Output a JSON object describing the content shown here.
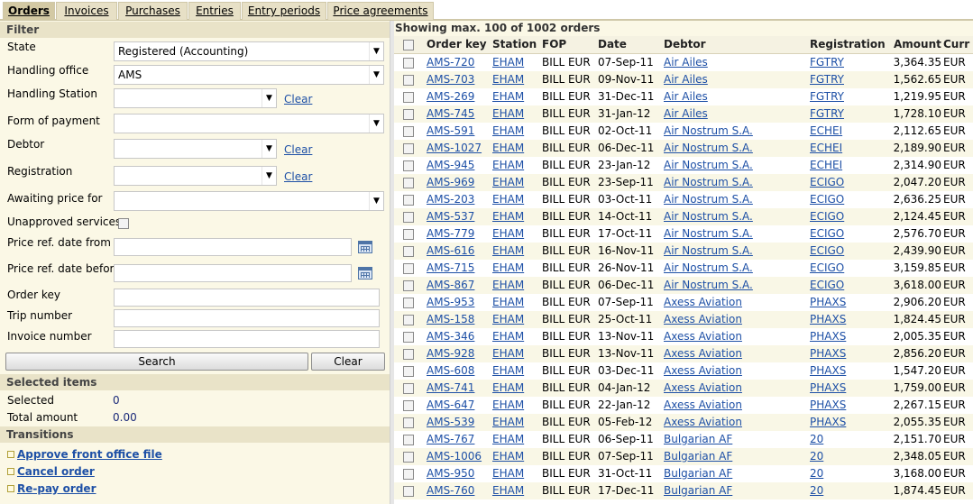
{
  "tabs": [
    {
      "label": "Orders",
      "active": true
    },
    {
      "label": "Invoices",
      "active": false
    },
    {
      "label": "Purchases",
      "active": false
    },
    {
      "label": "Entries",
      "active": false
    },
    {
      "label": "Entry periods",
      "active": false
    },
    {
      "label": "Price agreements",
      "active": false
    }
  ],
  "filter": {
    "header": "Filter",
    "state_label": "State",
    "state_value": "Registered (Accounting)",
    "handling_office_label": "Handling office",
    "handling_office_value": "AMS",
    "handling_station_label": "Handling Station",
    "form_of_payment_label": "Form of payment",
    "debtor_label": "Debtor",
    "registration_label": "Registration",
    "awaiting_price_label": "Awaiting price for",
    "unapproved_label": "Unapproved services",
    "price_from_label": "Price ref. date from",
    "price_before_label": "Price ref. date before",
    "order_key_label": "Order key",
    "trip_number_label": "Trip number",
    "invoice_number_label": "Invoice number",
    "clear_link": "Clear",
    "search_button": "Search",
    "clear_button": "Clear"
  },
  "selected": {
    "header": "Selected items",
    "selected_label": "Selected",
    "selected_value": "0",
    "total_label": "Total amount",
    "total_value": "0.00"
  },
  "transitions": {
    "header": "Transitions",
    "items": [
      "Approve front office file",
      "Cancel order",
      "Re-pay order"
    ]
  },
  "orders": {
    "showing": "Showing max. 100 of 1002 orders",
    "columns": [
      "Order key",
      "Station",
      "FOP",
      "Date",
      "Debtor",
      "Registration",
      "Amount",
      "Curr"
    ],
    "rows": [
      [
        "AMS-720",
        "EHAM",
        "BILL EUR",
        "07-Sep-11",
        "Air Ailes",
        "FGTRY",
        "3,364.35",
        "EUR"
      ],
      [
        "AMS-703",
        "EHAM",
        "BILL EUR",
        "09-Nov-11",
        "Air Ailes",
        "FGTRY",
        "1,562.65",
        "EUR"
      ],
      [
        "AMS-269",
        "EHAM",
        "BILL EUR",
        "31-Dec-11",
        "Air Ailes",
        "FGTRY",
        "1,219.95",
        "EUR"
      ],
      [
        "AMS-745",
        "EHAM",
        "BILL EUR",
        "31-Jan-12",
        "Air Ailes",
        "FGTRY",
        "1,728.10",
        "EUR"
      ],
      [
        "AMS-591",
        "EHAM",
        "BILL EUR",
        "02-Oct-11",
        "Air Nostrum S.A.",
        "ECHEI",
        "2,112.65",
        "EUR"
      ],
      [
        "AMS-1027",
        "EHAM",
        "BILL EUR",
        "06-Dec-11",
        "Air Nostrum S.A.",
        "ECHEI",
        "2,189.90",
        "EUR"
      ],
      [
        "AMS-945",
        "EHAM",
        "BILL EUR",
        "23-Jan-12",
        "Air Nostrum S.A.",
        "ECHEI",
        "2,314.90",
        "EUR"
      ],
      [
        "AMS-969",
        "EHAM",
        "BILL EUR",
        "23-Sep-11",
        "Air Nostrum S.A.",
        "ECIGO",
        "2,047.20",
        "EUR"
      ],
      [
        "AMS-203",
        "EHAM",
        "BILL EUR",
        "03-Oct-11",
        "Air Nostrum S.A.",
        "ECIGO",
        "2,636.25",
        "EUR"
      ],
      [
        "AMS-537",
        "EHAM",
        "BILL EUR",
        "14-Oct-11",
        "Air Nostrum S.A.",
        "ECIGO",
        "2,124.45",
        "EUR"
      ],
      [
        "AMS-779",
        "EHAM",
        "BILL EUR",
        "17-Oct-11",
        "Air Nostrum S.A.",
        "ECIGO",
        "2,576.70",
        "EUR"
      ],
      [
        "AMS-616",
        "EHAM",
        "BILL EUR",
        "16-Nov-11",
        "Air Nostrum S.A.",
        "ECIGO",
        "2,439.90",
        "EUR"
      ],
      [
        "AMS-715",
        "EHAM",
        "BILL EUR",
        "26-Nov-11",
        "Air Nostrum S.A.",
        "ECIGO",
        "3,159.85",
        "EUR"
      ],
      [
        "AMS-867",
        "EHAM",
        "BILL EUR",
        "06-Dec-11",
        "Air Nostrum S.A.",
        "ECIGO",
        "3,618.00",
        "EUR"
      ],
      [
        "AMS-953",
        "EHAM",
        "BILL EUR",
        "07-Sep-11",
        "Axess Aviation",
        "PHAXS",
        "2,906.20",
        "EUR"
      ],
      [
        "AMS-158",
        "EHAM",
        "BILL EUR",
        "25-Oct-11",
        "Axess Aviation",
        "PHAXS",
        "1,824.45",
        "EUR"
      ],
      [
        "AMS-346",
        "EHAM",
        "BILL EUR",
        "13-Nov-11",
        "Axess Aviation",
        "PHAXS",
        "2,005.35",
        "EUR"
      ],
      [
        "AMS-928",
        "EHAM",
        "BILL EUR",
        "13-Nov-11",
        "Axess Aviation",
        "PHAXS",
        "2,856.20",
        "EUR"
      ],
      [
        "AMS-608",
        "EHAM",
        "BILL EUR",
        "03-Dec-11",
        "Axess Aviation",
        "PHAXS",
        "1,547.20",
        "EUR"
      ],
      [
        "AMS-741",
        "EHAM",
        "BILL EUR",
        "04-Jan-12",
        "Axess Aviation",
        "PHAXS",
        "1,759.00",
        "EUR"
      ],
      [
        "AMS-647",
        "EHAM",
        "BILL EUR",
        "22-Jan-12",
        "Axess Aviation",
        "PHAXS",
        "2,267.15",
        "EUR"
      ],
      [
        "AMS-539",
        "EHAM",
        "BILL EUR",
        "05-Feb-12",
        "Axess Aviation",
        "PHAXS",
        "2,055.35",
        "EUR"
      ],
      [
        "AMS-767",
        "EHAM",
        "BILL EUR",
        "06-Sep-11",
        "Bulgarian AF",
        "20",
        "2,151.70",
        "EUR"
      ],
      [
        "AMS-1006",
        "EHAM",
        "BILL EUR",
        "07-Sep-11",
        "Bulgarian AF",
        "20",
        "2,348.05",
        "EUR"
      ],
      [
        "AMS-950",
        "EHAM",
        "BILL EUR",
        "31-Oct-11",
        "Bulgarian AF",
        "20",
        "3,168.00",
        "EUR"
      ],
      [
        "AMS-760",
        "EHAM",
        "BILL EUR",
        "17-Dec-11",
        "Bulgarian AF",
        "20",
        "1,874.45",
        "EUR"
      ]
    ]
  }
}
